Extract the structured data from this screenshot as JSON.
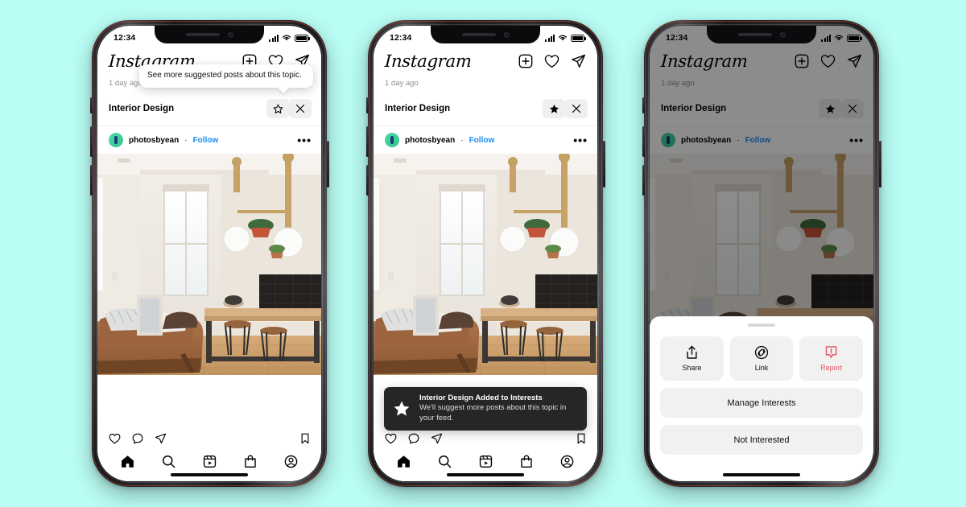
{
  "background_color": "#b9fdf4",
  "status_bar": {
    "time": "12:34",
    "signal_icon": "cellular-bars-icon",
    "wifi_icon": "wifi-icon",
    "battery_icon": "battery-full-icon"
  },
  "app": {
    "logo_text": "Instagram",
    "header_icons": [
      {
        "name": "new-post-icon",
        "label": "New Post"
      },
      {
        "name": "heart-icon",
        "label": "Activity"
      },
      {
        "name": "messenger-icon",
        "label": "Messages"
      }
    ]
  },
  "feed": {
    "timestamp": "1 day ago",
    "topic_label": "Interior Design",
    "topic_actions": [
      {
        "name": "star-outline-icon",
        "label": "Add to interests"
      },
      {
        "name": "close-icon",
        "label": "Dismiss"
      }
    ],
    "post": {
      "username": "photosbyean",
      "separator": "·",
      "follow_label": "Follow",
      "more_label": "•••",
      "image_alt": "Minimal interior: living room with brown leather sofa, wood kitchen island with stools, globe pendant lights"
    }
  },
  "bottom_nav": [
    {
      "name": "nav-home",
      "label": "Home"
    },
    {
      "name": "nav-search",
      "label": "Search"
    },
    {
      "name": "nav-reels",
      "label": "Reels"
    },
    {
      "name": "nav-shop",
      "label": "Shop"
    },
    {
      "name": "nav-profile",
      "label": "Profile"
    }
  ],
  "post_action_icons": [
    {
      "name": "like-heart-icon",
      "label": "Like"
    },
    {
      "name": "comment-icon",
      "label": "Comment"
    },
    {
      "name": "share-icon",
      "label": "Share"
    },
    {
      "name": "save-bookmark-icon",
      "label": "Save"
    }
  ],
  "phone1": {
    "tooltip_text": "See more suggested posts about this topic.",
    "star_state": "outline"
  },
  "phone2": {
    "star_state": "filled",
    "toast": {
      "icon": "star-filled-icon",
      "title": "Interior Design Added to Interests",
      "body": "We'll suggest more posts about this topic in your feed."
    }
  },
  "phone3": {
    "star_state": "filled",
    "sheet": {
      "grabber": "drag-handle",
      "quick_actions": [
        {
          "name": "share-action",
          "icon": "share-upload-icon",
          "label": "Share"
        },
        {
          "name": "link-action",
          "icon": "link-chain-icon",
          "label": "Link"
        },
        {
          "name": "report-action",
          "icon": "report-flag-icon",
          "label": "Report",
          "color": "#e05263"
        }
      ],
      "list_actions": [
        {
          "name": "manage-interests-action",
          "label": "Manage Interests"
        },
        {
          "name": "not-interested-action",
          "label": "Not Interested"
        }
      ]
    }
  }
}
